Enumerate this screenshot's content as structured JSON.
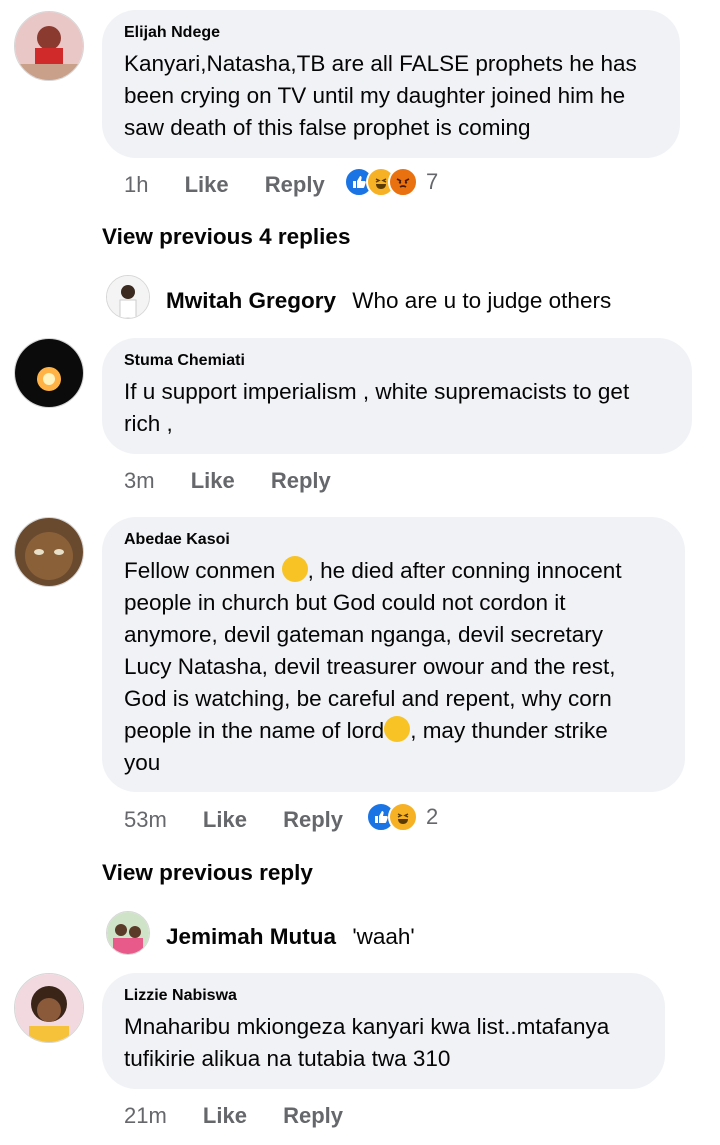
{
  "comments": [
    {
      "author": "Elijah Ndege",
      "lines": [
        "Kanyari,Natasha,TB are all FALSE prophets he has",
        "been crying on TV until my daughter joined him he",
        "saw death of this false prophet is coming"
      ],
      "time": "1h",
      "like": "Like",
      "reply": "Reply",
      "reaction_count": "7",
      "reactions": [
        "like",
        "haha",
        "angry"
      ]
    },
    {
      "author": "Stuma Chemiati",
      "lines": [
        "If u support imperialism , white supremacists to get",
        "rich ,"
      ],
      "time": "3m",
      "like": "Like",
      "reply": "Reply"
    },
    {
      "author": "Abedae Kasoi",
      "lines": [
        "Fellow conmen",
        ", he died after conning innocent",
        "people in church but God could not cordon it",
        "anymore,  devil gateman  nganga, devil secretary",
        "Lucy Natasha, devil treasurer owour and the rest,",
        "God is watching, be careful and repent, why corn",
        "people in the name of lord",
        ", may thunder strike",
        "you"
      ],
      "time": "53m",
      "like": "Like",
      "reply": "Reply",
      "reaction_count": "2",
      "reactions": [
        "like",
        "haha"
      ]
    },
    {
      "author": "Lizzie Nabiswa",
      "lines": [
        "Mnaharibu mkiongeza kanyari kwa list..mtafanya",
        "tufikirie alikua na tutabia twa 310"
      ],
      "time": "21m",
      "like": "Like",
      "reply": "Reply"
    }
  ],
  "view_previous": [
    "View previous 4 replies",
    "View previous reply"
  ],
  "replies": [
    {
      "author": "Mwitah Gregory",
      "text": "Who are u to judge others"
    },
    {
      "author": "Jemimah Mutua",
      "text": "'waah'"
    }
  ],
  "colors": {
    "bubble": "#f0f2f5",
    "meta": "#65676b",
    "like_blue": "#1b74e4",
    "haha_yellow": "#f7b125",
    "angry_orange": "#e9710f"
  }
}
